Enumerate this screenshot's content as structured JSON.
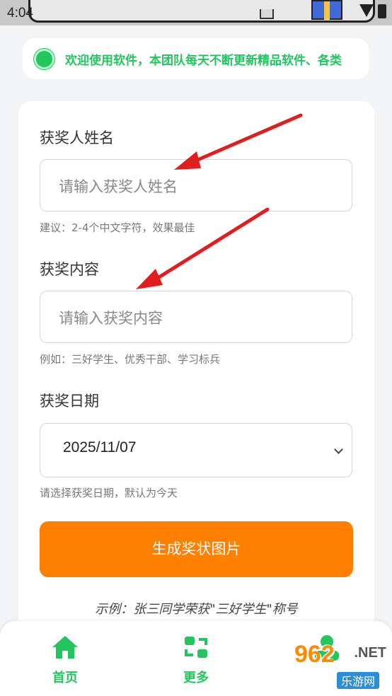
{
  "status_bar": {
    "time": "4:04"
  },
  "notice": {
    "text": "欢迎使用软件，本团队每天不断更新精品软件、各类"
  },
  "form": {
    "name": {
      "label": "获奖人姓名",
      "placeholder": "请输入获奖人姓名",
      "hint": "建议：2-4个中文字符，效果最佳"
    },
    "content": {
      "label": "获奖内容",
      "placeholder": "请输入获奖内容",
      "hint": "例如：三好学生、优秀干部、学习标兵"
    },
    "date": {
      "label": "获奖日期",
      "value": "2025/11/07",
      "hint": "请选择获奖日期，默认为今天"
    },
    "generate_label": "生成奖状图片",
    "example": "示例：张三同学荣获\"三好学生\"称号"
  },
  "bottom_nav": {
    "items": [
      {
        "label": "首页",
        "icon": "home-icon"
      },
      {
        "label": "更多",
        "icon": "refresh-icon"
      },
      {
        "label": "",
        "icon": "user-icon"
      }
    ]
  },
  "watermark": {
    "number": "962",
    "suffix": ".NET",
    "site": "乐游网"
  },
  "colors": {
    "accent_green": "#22c55e",
    "button_orange": "#ff7f00",
    "arrow_red": "#e11d1d"
  }
}
